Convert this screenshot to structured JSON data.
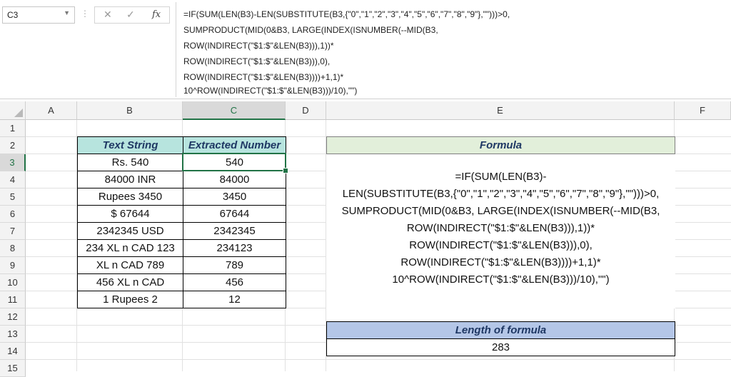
{
  "name_box": {
    "value": "C3"
  },
  "formula_bar": {
    "cancel_glyph": "✕",
    "enter_glyph": "✓",
    "fx_label": "fx",
    "lines": [
      "=IF(SUM(LEN(B3)-LEN(SUBSTITUTE(B3,{\"0\",\"1\",\"2\",\"3\",\"4\",\"5\",\"6\",\"7\",\"8\",\"9\"},\"\")))>0,",
      "SUMPRODUCT(MID(0&B3, LARGE(INDEX(ISNUMBER(--MID(B3,",
      "ROW(INDIRECT(\"$1:$\"&LEN(B3))),1))*",
      "ROW(INDIRECT(\"$1:$\"&LEN(B3))),0),",
      "ROW(INDIRECT(\"$1:$\"&LEN(B3))))+1,1)*",
      "10^ROW(INDIRECT(\"$1:$\"&LEN(B3)))/10),\"\")"
    ]
  },
  "columns": [
    "A",
    "B",
    "C",
    "D",
    "E",
    "F"
  ],
  "rows": [
    "1",
    "2",
    "3",
    "4",
    "5",
    "6",
    "7",
    "8",
    "9",
    "10",
    "11",
    "12",
    "13",
    "14",
    "15"
  ],
  "table": {
    "header_text_string": "Text String",
    "header_extracted_number": "Extracted Number",
    "rows": [
      {
        "text": "Rs. 540",
        "number": "540"
      },
      {
        "text": "84000 INR",
        "number": "84000"
      },
      {
        "text": "Rupees 3450",
        "number": "3450"
      },
      {
        "text": "$ 67644",
        "number": "67644"
      },
      {
        "text": "2342345 USD",
        "number": "2342345"
      },
      {
        "text": "234 XL n CAD 123",
        "number": "234123"
      },
      {
        "text": "XL n CAD 789",
        "number": "789"
      },
      {
        "text": "456 XL n CAD",
        "number": "456"
      },
      {
        "text": "1 Rupees 2",
        "number": "12"
      }
    ]
  },
  "formula_panel": {
    "title": "Formula",
    "lines": [
      "=IF(SUM(LEN(B3)-",
      "LEN(SUBSTITUTE(B3,{\"0\",\"1\",\"2\",\"3\",\"4\",\"5\",\"6\",\"7\",\"8\",\"9\"},\"\")))>0,",
      "SUMPRODUCT(MID(0&B3, LARGE(INDEX(ISNUMBER(--MID(B3,",
      "ROW(INDIRECT(\"$1:$\"&LEN(B3))),1))*",
      "ROW(INDIRECT(\"$1:$\"&LEN(B3))),0),",
      "ROW(INDIRECT(\"$1:$\"&LEN(B3))))+1,1)*",
      "10^ROW(INDIRECT(\"$1:$\"&LEN(B3)))/10),\"\")"
    ]
  },
  "length_panel": {
    "title": "Length of formula",
    "value": "283"
  },
  "colors": {
    "accent": "#217346",
    "table_header_fill": "#b7e4de",
    "formula_header_fill": "#e2efda",
    "length_header_fill": "#b4c6e7",
    "header_text": "#1f3864"
  }
}
